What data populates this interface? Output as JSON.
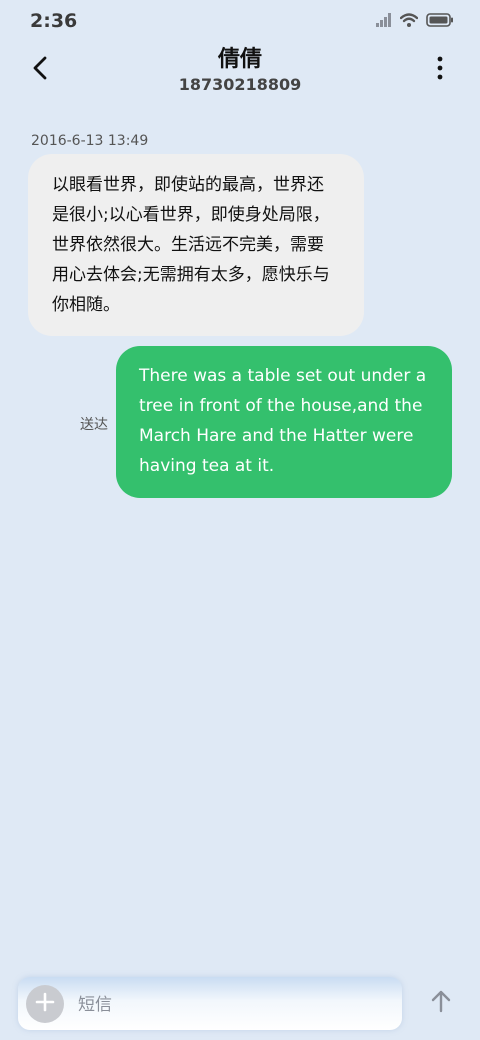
{
  "status_bar": {
    "time": "2:36",
    "icons": [
      "signal-icon",
      "wifi-icon",
      "battery-icon"
    ]
  },
  "header": {
    "contact_name": "倩倩",
    "contact_number": "18730218809",
    "back_icon": "chevron-left-icon",
    "more_icon": "more-vertical-icon"
  },
  "conversation": {
    "timestamp": "2016-6-13 13:49",
    "messages": [
      {
        "direction": "incoming",
        "text": "以眼看世界，即使站的最高，世界还是很小;以心看世界，即使身处局限，世界依然很大。生活远不完美，需要用心去体会;无需拥有太多，愿快乐与你相随。"
      },
      {
        "direction": "outgoing",
        "text": "There was a table set out under a tree in front of the house,and the March Hare and the Hatter were having tea at it.",
        "status": "送达"
      }
    ]
  },
  "composer": {
    "placeholder": "短信",
    "value": "",
    "add_icon": "plus-icon",
    "send_icon": "arrow-up-icon"
  },
  "colors": {
    "background": "#dfe9f5",
    "incoming_bubble": "#efefef",
    "outgoing_bubble": "#34c06d",
    "outgoing_text": "#ffffff"
  }
}
